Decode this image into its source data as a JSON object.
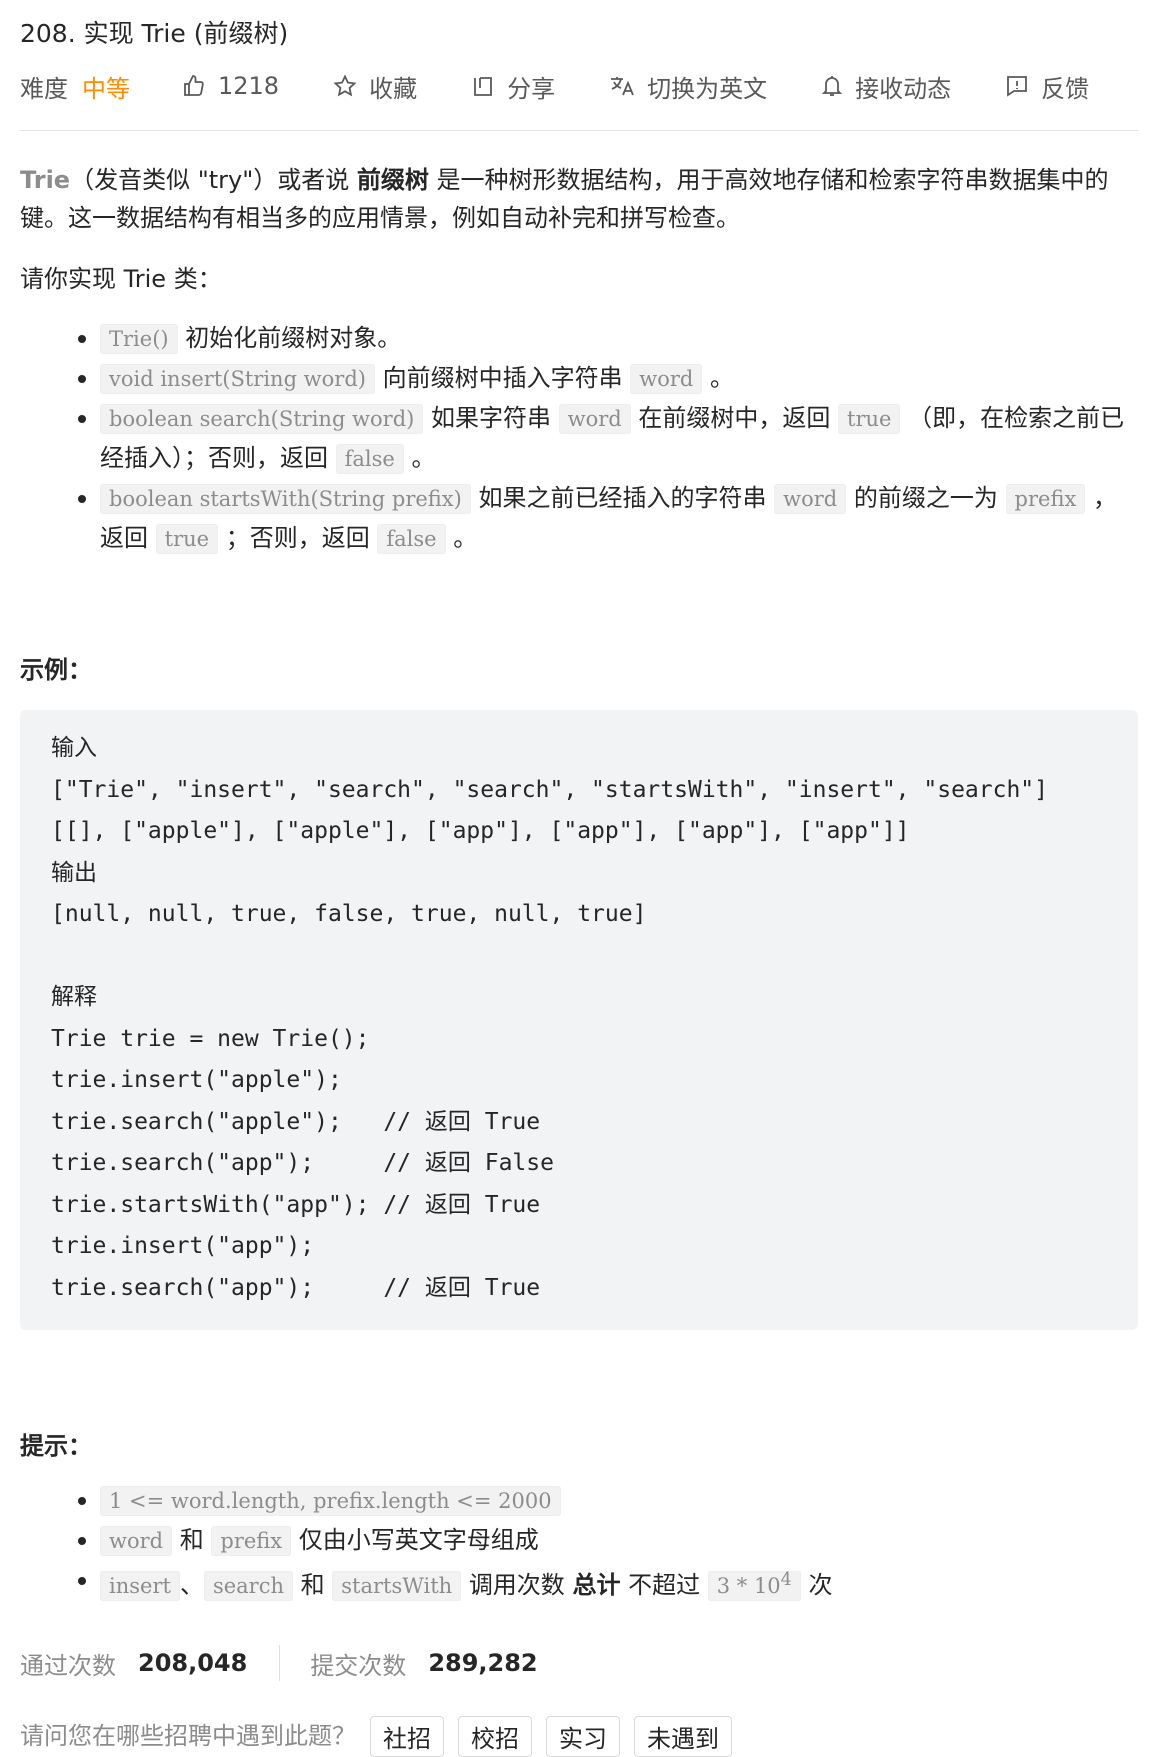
{
  "title": "208. 实现 Trie (前缀树)",
  "meta": {
    "difficulty_label": "难度",
    "difficulty": "中等",
    "likes": "1218",
    "collect": "收藏",
    "share": "分享",
    "switch_lang": "切换为英文",
    "subscribe": "接收动态",
    "feedback": "反馈"
  },
  "desc": {
    "trie": "Trie",
    "p1_a": "（发音类似 \"try\"）或者说",
    "prefix_tree": "前缀树",
    "p1_b": "是一种树形数据结构，用于高效地存储和检索字符串数据集中的键。这一数据结构有相当多的应用情景，例如自动补完和拼写检查。",
    "p2": "请你实现 Trie 类："
  },
  "methods": [
    {
      "code": "Trie()",
      "text": "初始化前缀树对象。"
    },
    {
      "code": "void insert(String word)",
      "text": "向前缀树中插入字符串",
      "code2": "word",
      "end": "。"
    },
    {
      "code": "boolean search(String word)",
      "text": "如果字符串",
      "code2": "word",
      "text2": "在前缀树中，返回",
      "code3": "true",
      "text3": "（即，在检索之前已经插入）；否则，返回",
      "code4": "false",
      "end": "。"
    },
    {
      "code": "boolean startsWith(String prefix)",
      "text": "如果之前已经插入的字符串",
      "code2": "word",
      "text2": "的前缀之一为",
      "code3": "prefix",
      "text3": "，返回",
      "code4": "true",
      "text4": "；否则，返回",
      "code5": "false",
      "end": "。"
    }
  ],
  "example": {
    "heading": "示例：",
    "lines": [
      "输入",
      "[\"Trie\", \"insert\", \"search\", \"search\", \"startsWith\", \"insert\", \"search\"]",
      "[[], [\"apple\"], [\"apple\"], [\"app\"], [\"app\"], [\"app\"], [\"app\"]]",
      "输出",
      "[null, null, true, false, true, null, true]",
      "",
      "解释",
      "Trie trie = new Trie();",
      "trie.insert(\"apple\");",
      "trie.search(\"apple\");   // 返回 True",
      "trie.search(\"app\");     // 返回 False",
      "trie.startsWith(\"app\"); // 返回 True",
      "trie.insert(\"app\");",
      "trie.search(\"app\");     // 返回 True"
    ]
  },
  "hints": {
    "heading": "提示：",
    "h1": "1 <= word.length, prefix.length <= 2000",
    "h2_code1": "word",
    "h2_and": "和",
    "h2_code2": "prefix",
    "h2_text": "仅由小写英文字母组成",
    "h3_code1": "insert",
    "h3_sep": "、",
    "h3_code2": "search",
    "h3_and": "和",
    "h3_code3": "startsWith",
    "h3_text1": "调用次数",
    "h3_bold": "总计",
    "h3_text2": "不超过",
    "h3_code4": "3 * 10",
    "h3_sup": "4",
    "h3_end": "次"
  },
  "stats": {
    "passed_label": "通过次数",
    "passed": "208,048",
    "submitted_label": "提交次数",
    "submitted": "289,282"
  },
  "bottom": {
    "question": "请问您在哪些招聘中遇到此题？",
    "tags": [
      "社招",
      "校招",
      "实习",
      "未遇到"
    ]
  }
}
